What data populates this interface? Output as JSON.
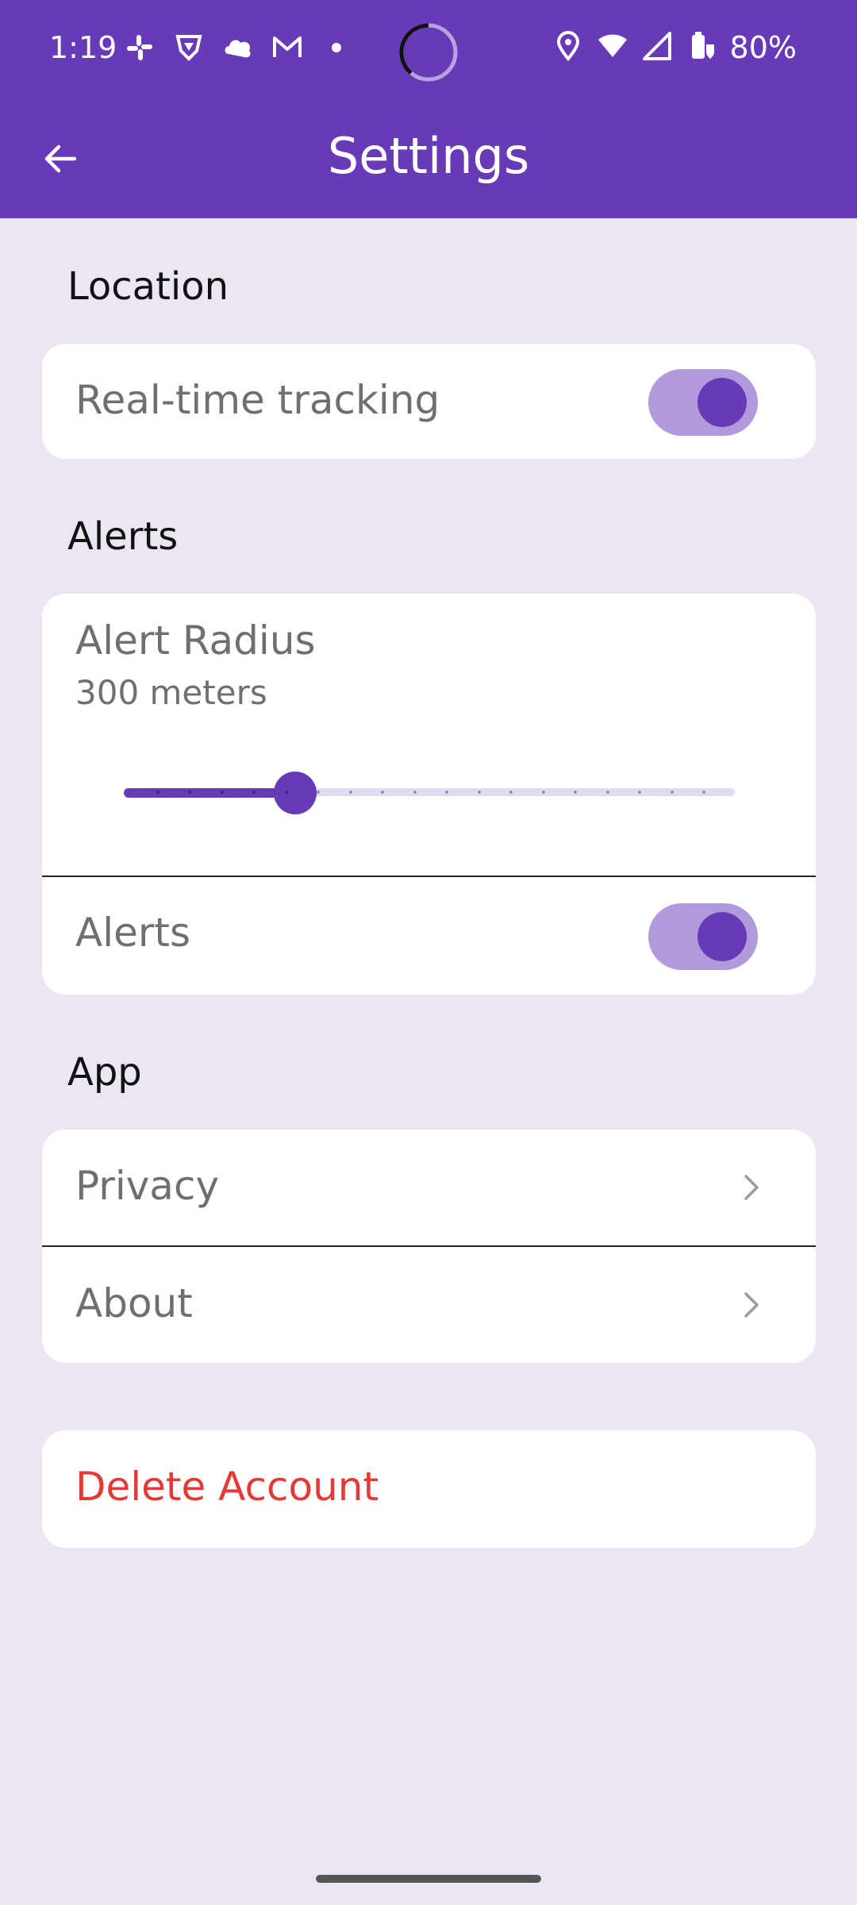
{
  "status_bar": {
    "time": "1:19",
    "battery": "80%",
    "icons": [
      "slack-icon",
      "shield-icon",
      "cloud-leaf-icon",
      "gmail-icon",
      "dot-icon",
      "location-icon",
      "wifi-icon",
      "signal-icon",
      "battery-icon"
    ]
  },
  "app_bar": {
    "title": "Settings",
    "back_icon": "arrow-left-icon"
  },
  "sections": {
    "location": {
      "title": "Location",
      "realtime_label": "Real-time tracking",
      "realtime_on": true
    },
    "alerts": {
      "title": "Alerts",
      "radius_label": "Alert Radius",
      "radius_value": "300 meters",
      "radius_fraction": 0.28,
      "alerts_label": "Alerts",
      "alerts_on": true
    },
    "app": {
      "title": "App",
      "privacy_label": "Privacy",
      "about_label": "About"
    }
  },
  "delete_account": {
    "label": "Delete Account"
  },
  "colors": {
    "primary": "#673AB7",
    "background": "#ECE6F3",
    "danger": "#E53935",
    "toggle_track": "#B19ADC"
  }
}
